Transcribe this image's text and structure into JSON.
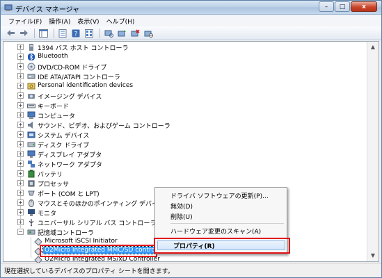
{
  "window": {
    "title": "デバイス マネージャ"
  },
  "window_buttons": {
    "minimize": "–",
    "maximize": "□",
    "close": "x"
  },
  "menubar": {
    "items": [
      "ファイル(F)",
      "操作(A)",
      "表示(V)",
      "ヘルプ(H)"
    ]
  },
  "toolbar": {
    "buttons": [
      "back-icon",
      "forward-icon",
      "show-hide-tree-icon",
      "properties-icon",
      "help-icon",
      "view-icon",
      "scan-hardware-icon",
      "update-driver-icon",
      "uninstall-icon",
      "disable-icon"
    ]
  },
  "tree": {
    "categories": [
      "1394 バス ホスト コントローラ",
      "Bluetooth",
      "DVD/CD-ROM ドライブ",
      "IDE ATA/ATAPI コントローラ",
      "Personal identification devices",
      "イメージング デバイス",
      "キーボード",
      "コンピュータ",
      "サウンド、ビデオ、およびゲーム コントローラ",
      "システム デバイス",
      "ディスク ドライブ",
      "ディスプレイ アダプタ",
      "ネットワーク アダプタ",
      "バッテリ",
      "プロセッサ",
      "ポート (COM と LPT)",
      "マウスとそのほかのポインティング デバイス",
      "モニタ",
      "ユニバーサル シリアル バス コントローラ",
      "記憶域コントローラ"
    ],
    "expanded_children": [
      "Microsoft iSCSI Initiator",
      "O2Micro Integrated MMC/SD controller",
      "O2Micro Integrated MS/xD Controller"
    ],
    "selected": "O2Micro Integrated MMC/SD controller"
  },
  "context_menu": {
    "items": [
      "ドライバ ソフトウェアの更新(P)...",
      "無効(D)",
      "削除(U)",
      "ハードウェア変更のスキャン(A)",
      "プロパティ(R)"
    ],
    "highlighted": "プロパティ(R)"
  },
  "statusbar": {
    "text": "現在選択しているデバイスのプロパティ シートを開きます。"
  },
  "colors": {
    "selection": "#3399ff",
    "callout": "#e1141a",
    "title_gradient": "#b9cfe6"
  }
}
